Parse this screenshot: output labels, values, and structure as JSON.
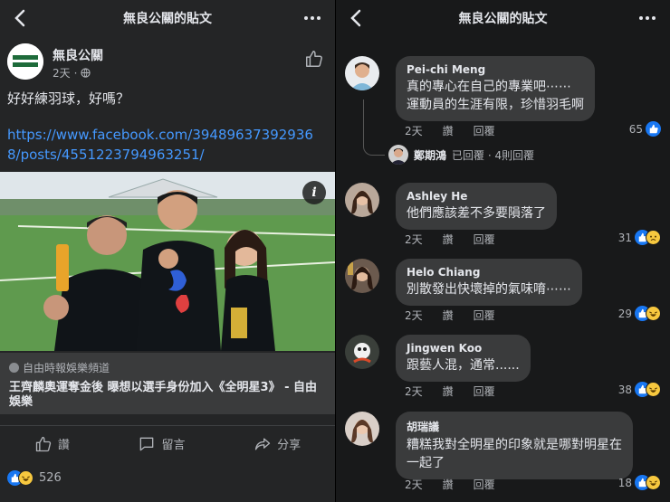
{
  "left": {
    "header_title": "無良公關的貼文",
    "page_name": "無良公關",
    "post_age": "2天",
    "post_text": "好好練羽球，好嗎？",
    "link_url": "https://www.facebook.com/394896373929368/posts/4551223794963251/",
    "link_source": "自由時報娛樂頻道",
    "link_headline": "王齊麟奧運奪金後 曝想以選手身份加入《全明星3》 - 自由娛樂",
    "actions": {
      "like": "讚",
      "comment": "留言",
      "share": "分享"
    },
    "reaction_count": "526"
  },
  "right": {
    "header_title": "無良公關的貼文",
    "comments": [
      {
        "name": "Pei-chi Meng",
        "lines": [
          "真的專心在自己的專業吧⋯⋯",
          "運動員的生涯有限，珍惜羽毛啊"
        ],
        "age": "2天",
        "like": "讚",
        "reply": "回覆",
        "count": "65"
      },
      {
        "name": "Ashley He",
        "lines": [
          "他們應該差不多要隕落了"
        ],
        "age": "2天",
        "like": "讚",
        "reply": "回覆",
        "count": "31"
      },
      {
        "name": "Helo Chiang",
        "lines": [
          "別散發出快壞掉的氣味唷⋯⋯"
        ],
        "age": "2天",
        "like": "讚",
        "reply": "回覆",
        "count": "29"
      },
      {
        "name": "Jingwen Koo",
        "lines": [
          "跟藝人混，通常......"
        ],
        "age": "2天",
        "like": "讚",
        "reply": "回覆",
        "count": "38"
      },
      {
        "name": "胡瑞議",
        "lines": [
          "糟糕我對全明星的印象就是哪對明星在",
          "一起了"
        ],
        "age": "2天",
        "like": "讚",
        "reply": "回覆",
        "count": "18"
      }
    ],
    "reply_thread": {
      "name": "鄭期鴻",
      "text": "已回覆 · 4則回覆"
    }
  },
  "colors": {
    "link": "#4599ff",
    "like_blue": "#1877f2",
    "emoji_yellow": "#f7c83f"
  }
}
